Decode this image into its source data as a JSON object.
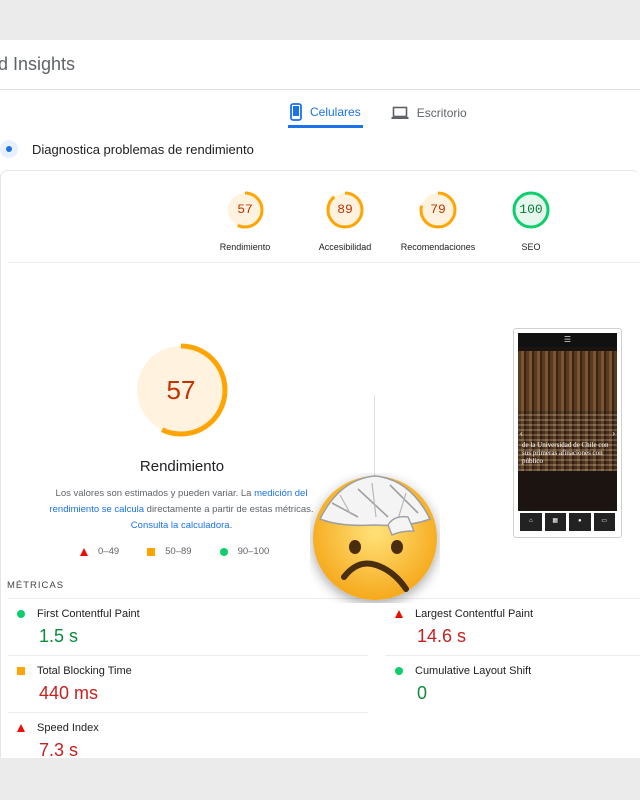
{
  "header": {
    "title": "d Insights"
  },
  "tabs": [
    {
      "label": "Celulares"
    },
    {
      "label": "Escritorio"
    }
  ],
  "diagnostic": {
    "label": "Diagnostica problemas de rendimiento"
  },
  "gauges": [
    {
      "score": "57",
      "label": "Rendimiento",
      "fraction": 0.57,
      "color": "#ffa400"
    },
    {
      "score": "89",
      "label": "Accesibilidad",
      "fraction": 0.89,
      "color": "#ffa400"
    },
    {
      "score": "79",
      "label": "Recomendaciones",
      "fraction": 0.79,
      "color": "#ffa400"
    },
    {
      "score": "100",
      "label": "SEO",
      "fraction": 1.0,
      "color": "#0cce6b"
    }
  ],
  "performance": {
    "score": "57",
    "title": "Rendimiento",
    "desc_1": "Los valores son estimados y pueden variar. La ",
    "desc_link_1": "medición del rendimiento se calcula",
    "desc_2": " directamente a partir de estas métricas. ",
    "desc_link_2": "Consulta la calculadora",
    "desc_3": "."
  },
  "legend": [
    {
      "range": "0–49"
    },
    {
      "range": "50–89"
    },
    {
      "range": "90–100"
    }
  ],
  "screenshot": {
    "caption": "de la Universidad de Chile con sus primeras afinaciones con público"
  },
  "metrics_heading": "MÉTRICAS",
  "metrics": [
    {
      "name": "First Contentful Paint",
      "value": "1.5 s",
      "status": "pass"
    },
    {
      "name": "Largest Contentful Paint",
      "value": "14.6 s",
      "status": "fail"
    },
    {
      "name": "Total Blocking Time",
      "value": "440 ms",
      "status": "average"
    },
    {
      "name": "Cumulative Layout Shift",
      "value": "0",
      "status": "pass"
    },
    {
      "name": "Speed Index",
      "value": "7.3 s",
      "status": "fail"
    }
  ],
  "colors": {
    "accent": "#1a73e8",
    "pass": "#0cce6b",
    "average": "#ffa400",
    "fail": "#eb0f00"
  },
  "overlay": {
    "icon": "face-with-head-bandage-icon"
  }
}
